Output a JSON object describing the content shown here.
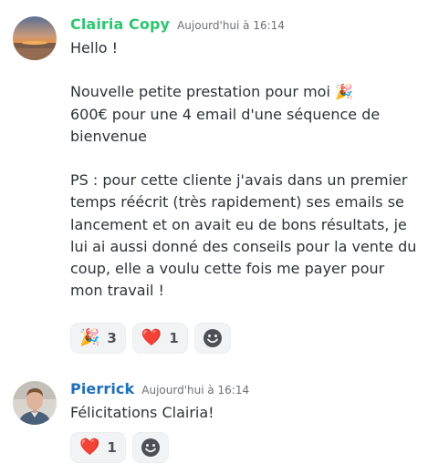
{
  "messages": [
    {
      "author": "Clairia Copy",
      "author_color": "#2dc770",
      "timestamp": "Aujourd'hui à 16:14",
      "lines": [
        "Hello !",
        "",
        "",
        "Nouvelle petite prestation pour moi 🎉",
        "600€ pour une 4 email d'une séquence de",
        "bienvenue",
        "",
        "PS : pour cette cliente j'avais dans un premier",
        "temps réécrit (très rapidement) ses emails se",
        "lancement et on avait eu de bons résultats, je",
        "lui ai aussi donné des conseils pour la vente du",
        "coup, elle a voulu cette fois me payer pour",
        "mon travail !"
      ],
      "reactions": [
        {
          "emoji": "🎉",
          "count": "3"
        },
        {
          "emoji": "❤️",
          "count": "1"
        }
      ],
      "add_reaction_icon": "smiley-face-icon"
    },
    {
      "author": "Pierrick",
      "author_color": "#1f6fb8",
      "timestamp": "Aujourd'hui à 16:14",
      "lines": [
        "Félicitations Clairia!"
      ],
      "reactions": [
        {
          "emoji": "❤️",
          "count": "1"
        }
      ],
      "add_reaction_icon": "smiley-face-icon"
    }
  ]
}
